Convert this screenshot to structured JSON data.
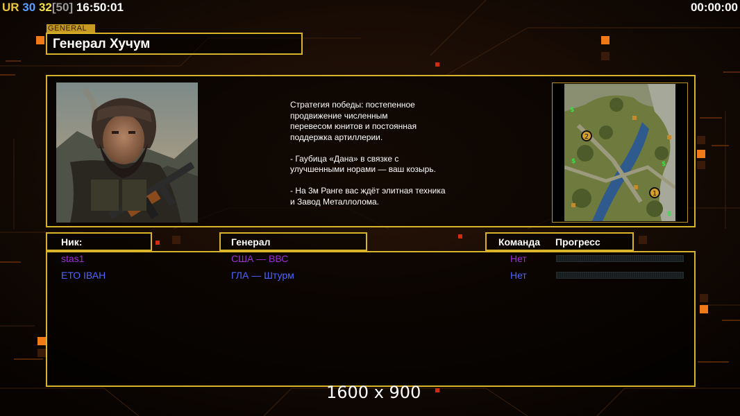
{
  "hud": {
    "ur_label": "UR",
    "ur_color": "#e8c640",
    "value1": "30",
    "value1_color": "#5aa0ff",
    "value2": "32",
    "value2_color": "#f2e24a",
    "bracket_value": "[50]",
    "bracket_color": "#9a9a9a",
    "clock": "16:50:01",
    "timer": "00:00:00"
  },
  "general": {
    "tag": "GENERAL",
    "name": "Генерал Хучум",
    "description": "Стратегия победы: постепенное\nпродвижение численным\nперевесом юнитов и постоянная\nподдержка артиллерии.\n\n- Гаубица «Дана» в связке с\nулучшенными норами — ваш козырь.\n\n- На 3м Ранге вас ждёт элитная техника\nи Завод Металлолома."
  },
  "minimap": {
    "start_positions": [
      "2",
      "1"
    ],
    "supply_marker": "$"
  },
  "columns": {
    "nick": "Ник:",
    "general": "Генерал",
    "team": "Команда",
    "progress": "Прогресс"
  },
  "players": [
    {
      "nick": "stas1",
      "general": "США — ВВС",
      "team": "Нет",
      "color": "#9b2fd6",
      "progress": 0
    },
    {
      "nick": "ЕТО ІВАН",
      "general": "ГЛА — Штурм",
      "team": "Нет",
      "color": "#4f63ff",
      "progress": 0
    }
  ],
  "resolution": "1600 x 900",
  "colors": {
    "frame": "#d8b42a",
    "accent_orange": "#f07a18",
    "background": "#0b0502"
  }
}
